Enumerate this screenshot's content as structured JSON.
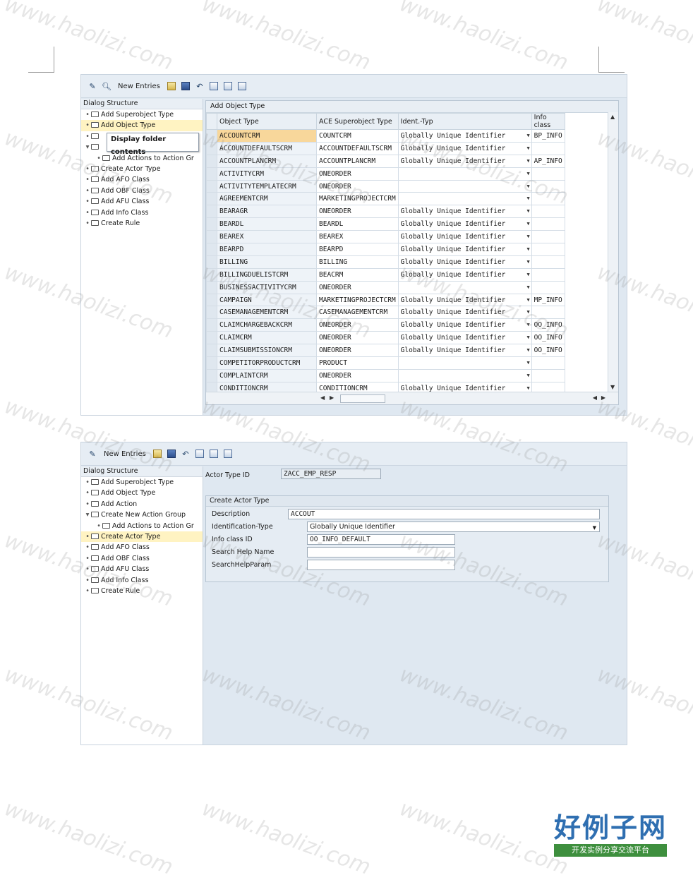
{
  "watermark": "www.haolizi.com",
  "brand_logo": {
    "title": "好例子网",
    "subtitle": "开发实例分享交流平台"
  },
  "screen1": {
    "toolbar": {
      "new_entries": "New Entries"
    },
    "tree": {
      "title": "Dialog Structure",
      "items": [
        {
          "label": "Add Superobject Type",
          "level": 1,
          "selected": false
        },
        {
          "label": "Add Object Type",
          "level": 1,
          "selected": true
        },
        {
          "label": "",
          "level": 1,
          "selected": false
        },
        {
          "label": "",
          "level": 1,
          "selected": false
        },
        {
          "label": "Add Actions to Action Gr",
          "level": 2,
          "selected": false
        },
        {
          "label": "Create Actor Type",
          "level": 1,
          "selected": false
        },
        {
          "label": "Add AFO Class",
          "level": 1,
          "selected": false
        },
        {
          "label": "Add OBF Class",
          "level": 1,
          "selected": false
        },
        {
          "label": "Add AFU Class",
          "level": 1,
          "selected": false
        },
        {
          "label": "Add Info Class",
          "level": 1,
          "selected": false
        },
        {
          "label": "Create Rule",
          "level": 1,
          "selected": false
        }
      ],
      "tooltip": "Display folder contents"
    },
    "grid": {
      "title": "Add Object Type",
      "columns": [
        "Object Type",
        "ACE Superobject Type",
        "Ident.-Typ",
        "Info class"
      ],
      "rows": [
        [
          "ACCOUNTCRM",
          "COUNTCRM",
          "Globally Unique Identifier",
          "BP_INFO"
        ],
        [
          "ACCOUNTDEFAULTSCRM",
          "ACCOUNTDEFAULTSCRM",
          "Globally Unique Identifier",
          ""
        ],
        [
          "ACCOUNTPLANCRM",
          "ACCOUNTPLANCRM",
          "Globally Unique Identifier",
          "AP_INFO"
        ],
        [
          "ACTIVITYCRM",
          "ONEORDER",
          "",
          ""
        ],
        [
          "ACTIVITYTEMPLATECRM",
          "ONEORDER",
          "",
          ""
        ],
        [
          "AGREEMENTCRM",
          "MARKETINGPROJECTCRM",
          "",
          ""
        ],
        [
          "BEARAGR",
          "ONEORDER",
          "Globally Unique Identifier",
          ""
        ],
        [
          "BEARDL",
          "BEARDL",
          "Globally Unique Identifier",
          ""
        ],
        [
          "BEAREX",
          "BEAREX",
          "Globally Unique Identifier",
          ""
        ],
        [
          "BEARPD",
          "BEARPD",
          "Globally Unique Identifier",
          ""
        ],
        [
          "BILLING",
          "BILLING",
          "Globally Unique Identifier",
          ""
        ],
        [
          "BILLINGDUELISTCRM",
          "BEACRM",
          "Globally Unique Identifier",
          ""
        ],
        [
          "BUSINESSACTIVITYCRM",
          "ONEORDER",
          "",
          ""
        ],
        [
          "CAMPAIGN",
          "MARKETINGPROJECTCRM",
          "Globally Unique Identifier",
          "MP_INFO"
        ],
        [
          "CASEMANAGEMENTCRM",
          "CASEMANAGEMENTCRM",
          "Globally Unique Identifier",
          ""
        ],
        [
          "CLAIMCHARGEBACKCRM",
          "ONEORDER",
          "Globally Unique Identifier",
          "OO_INFO"
        ],
        [
          "CLAIMCRM",
          "ONEORDER",
          "Globally Unique Identifier",
          "OO_INFO"
        ],
        [
          "CLAIMSUBMISSIONCRM",
          "ONEORDER",
          "Globally Unique Identifier",
          "OO_INFO"
        ],
        [
          "COMPETITORPRODUCTCRM",
          "PRODUCT",
          "",
          ""
        ],
        [
          "COMPLAINTCRM",
          "ONEORDER",
          "",
          ""
        ],
        [
          "CONDITIONCRM",
          "CONDITIONCRM",
          "Globally Unique Identifier",
          ""
        ]
      ]
    }
  },
  "screen2": {
    "toolbar": {
      "new_entries": "New Entries"
    },
    "tree": {
      "title": "Dialog Structure",
      "items": [
        {
          "label": "Add Superobject Type",
          "level": 1,
          "selected": false
        },
        {
          "label": "Add Object Type",
          "level": 1,
          "selected": false
        },
        {
          "label": "Add Action",
          "level": 1,
          "selected": false
        },
        {
          "label": "Create New Action Group",
          "level": 1,
          "selected": false
        },
        {
          "label": "Add Actions to Action Gr",
          "level": 2,
          "selected": false
        },
        {
          "label": "Create Actor Type",
          "level": 1,
          "selected": true
        },
        {
          "label": "Add AFO Class",
          "level": 1,
          "selected": false
        },
        {
          "label": "Add OBF Class",
          "level": 1,
          "selected": false
        },
        {
          "label": "Add AFU Class",
          "level": 1,
          "selected": false
        },
        {
          "label": "Add Info Class",
          "level": 1,
          "selected": false
        },
        {
          "label": "Create Rule",
          "level": 1,
          "selected": false
        }
      ]
    },
    "form": {
      "actor_type_id_label": "Actor Type ID",
      "actor_type_id_value": "ZACC_EMP_RESP",
      "group_title": "Create Actor Type",
      "description_label": "Description",
      "description_value": "ACCOUT",
      "identification_type_label": "Identification-Type",
      "identification_type_value": "Globally Unique Identifier",
      "info_class_id_label": "Info class ID",
      "info_class_id_value": "OO_INFO_DEFAULT",
      "search_help_name_label": "Search Help Name",
      "search_help_name_value": "",
      "search_help_param_label": "SearchHelpParam",
      "search_help_param_value": ""
    }
  }
}
